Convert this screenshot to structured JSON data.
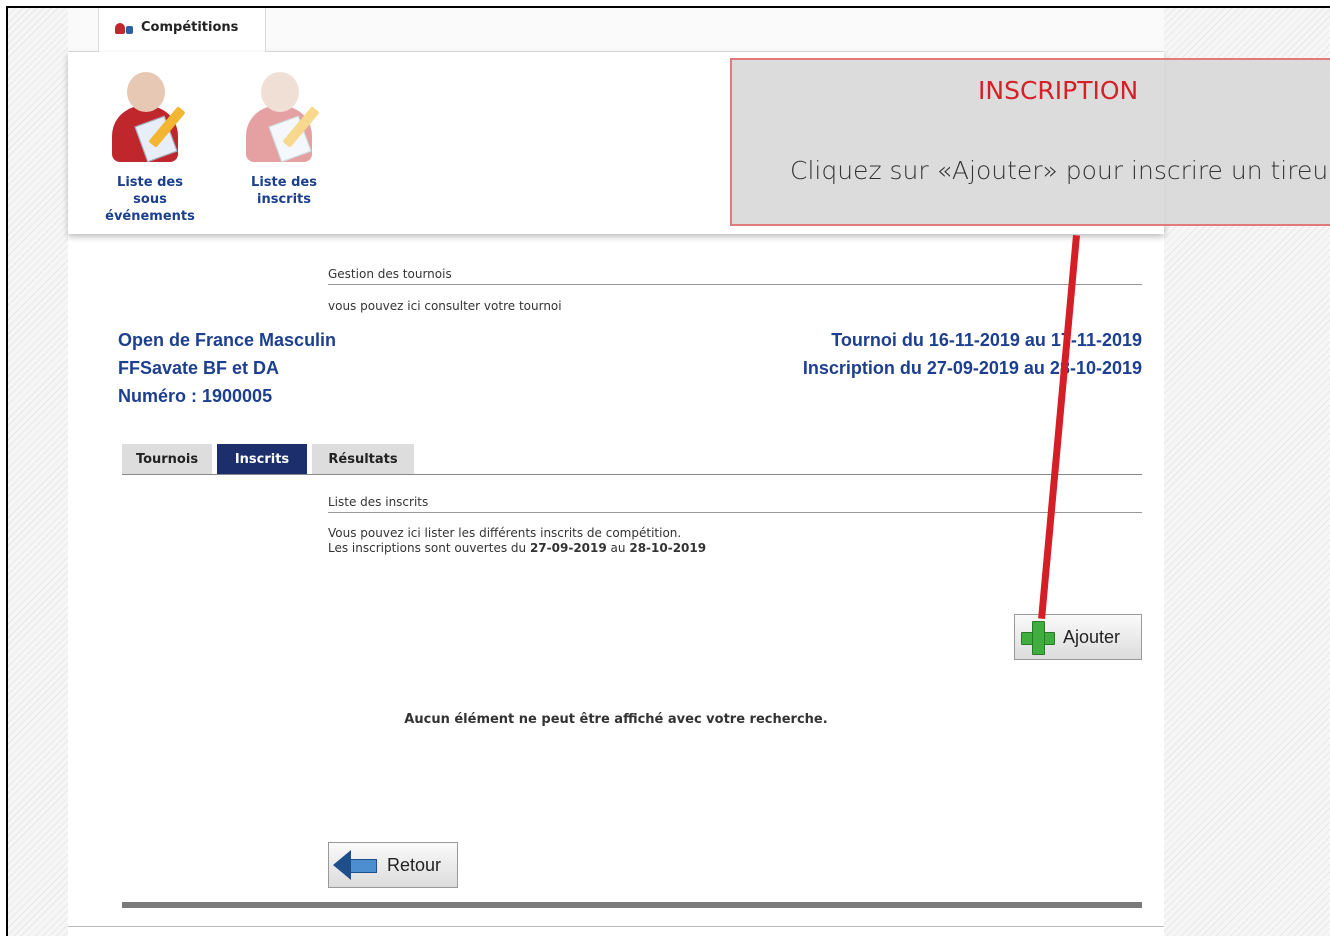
{
  "top_tab": {
    "label": "Compétitions"
  },
  "toolbar": {
    "items": [
      {
        "label_l1": "Liste des",
        "label_l2": "sous",
        "label_l3": "événements"
      },
      {
        "label_l1": "Liste des",
        "label_l2": "inscrits"
      }
    ]
  },
  "callout": {
    "title": "INSCRIPTION",
    "text": "Cliquez sur «Ajouter» pour inscrire un tireu"
  },
  "section": {
    "title": "Gestion des tournois",
    "subtitle": "vous pouvez ici consulter votre tournoi"
  },
  "tournament": {
    "name": "Open de France Masculin",
    "category": "FFSavate BF et DA",
    "number": "Numéro : 1900005",
    "dates": "Tournoi du 16-11-2019 au 17-11-2019",
    "registration": "Inscription du 27-09-2019 au 28-10-2019"
  },
  "tabs": [
    {
      "label": "Tournois"
    },
    {
      "label": "Inscrits"
    },
    {
      "label": "Résultats"
    }
  ],
  "list": {
    "title": "Liste des inscrits",
    "desc_line1": "Vous pouvez ici lister les différents inscrits de compétition.",
    "desc_prefix": "Les inscriptions sont ouvertes du",
    "start": "27-09-2019",
    "mid": "au",
    "end": "28-10-2019",
    "add_label": "Ajouter",
    "empty": "Aucun élément ne peut être affiché avec votre recherche.",
    "back_label": "Retour"
  },
  "colors": {
    "accent": "#1d3f8f",
    "active_tab": "#1c2e6b",
    "callout_red": "#d42027"
  }
}
